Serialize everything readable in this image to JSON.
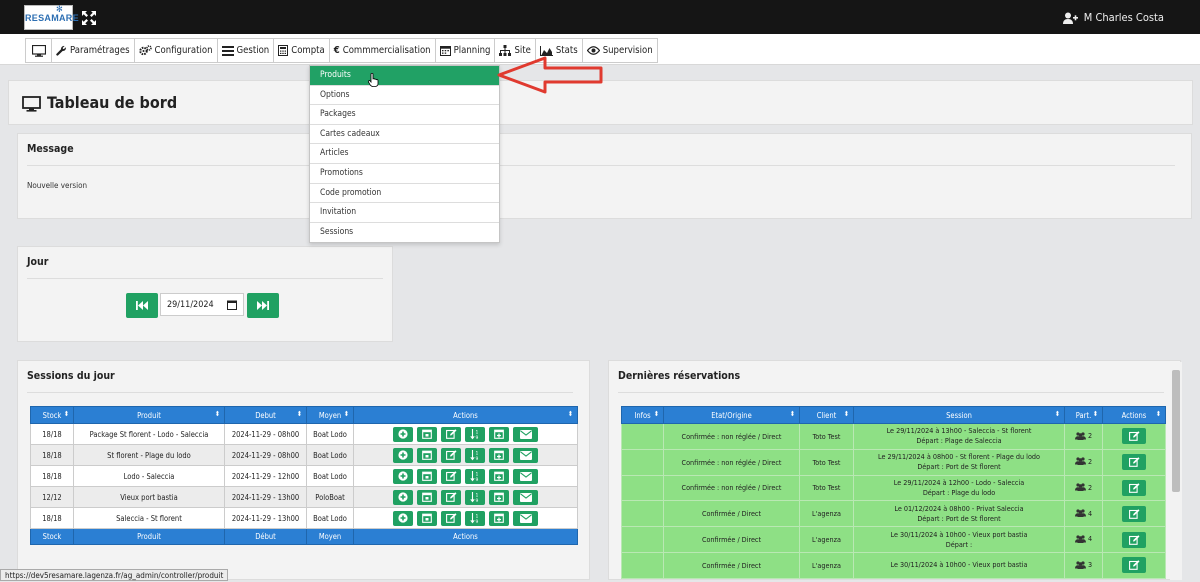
{
  "brand": {
    "logo_text": "RESAMARE"
  },
  "user": {
    "name": "M Charles Costa"
  },
  "menu": [
    {
      "label": ""
    },
    {
      "label": "Paramétrages",
      "icon": "wrench-icon"
    },
    {
      "label": "Configuration",
      "icon": "gears-icon"
    },
    {
      "label": "Gestion",
      "icon": "list-icon"
    },
    {
      "label": "Compta",
      "icon": "calculator-icon"
    },
    {
      "label": "Commmercialisation",
      "icon": "euro-icon"
    },
    {
      "label": "Planning",
      "icon": "calendar-icon"
    },
    {
      "label": "Site",
      "icon": "sitemap-icon"
    },
    {
      "label": "Stats",
      "icon": "area-chart-icon"
    },
    {
      "label": "Supervision",
      "icon": "eye-icon"
    }
  ],
  "dropdown": [
    "Produits",
    "Options",
    "Packages",
    "Cartes cadeaux",
    "Articles",
    "Promotions",
    "Code promotion",
    "Invitation",
    "Sessions"
  ],
  "page": {
    "title": "Tableau de bord"
  },
  "message": {
    "heading": "Message",
    "body": "Nouvelle version"
  },
  "jour": {
    "heading": "Jour",
    "date": "29/11/2024"
  },
  "sessions": {
    "heading": "Sessions du jour",
    "columns": [
      "Stock",
      "Produit",
      "Debut",
      "Moyen",
      "Actions"
    ],
    "footer": [
      "Stock",
      "Produit",
      "Début",
      "Moyen",
      "Actions"
    ],
    "rows": [
      [
        "18/18",
        "Package St florent - Lodo - Saleccia",
        "2024-11-29 - 08h00",
        "Boat Lodo"
      ],
      [
        "18/18",
        "St florent - Plage du lodo",
        "2024-11-29 - 08h00",
        "Boat Lodo"
      ],
      [
        "18/18",
        "Lodo - Saleccia",
        "2024-11-29 - 12h00",
        "Boat Lodo"
      ],
      [
        "12/12",
        "Vieux port bastia",
        "2024-11-29 - 13h00",
        "PoloBoat"
      ],
      [
        "18/18",
        "Saleccia - St florent",
        "2024-11-29 - 13h00",
        "Boat Lodo"
      ]
    ]
  },
  "reservations": {
    "heading": "Dernières réservations",
    "columns": [
      "Infos",
      "Etat/Origine",
      "Client",
      "Session",
      "Part.",
      "Actions"
    ],
    "rows": [
      [
        "",
        "Confirmée : non réglée / Direct",
        "Toto Test",
        "Le 29/11/2024 à 13h00 - Saleccia - St florent",
        "Départ : Plage de Saleccia",
        "2"
      ],
      [
        "",
        "Confirmée : non réglée / Direct",
        "Toto Test",
        "Le 29/11/2024 à 08h00 - St florent - Plage du lodo",
        "Départ : Port de St florent",
        "2"
      ],
      [
        "",
        "Confirmée : non réglée / Direct",
        "Toto Test",
        "Le 29/11/2024 à 12h00 - Lodo - Saleccia",
        "Départ : Plage du lodo",
        "2"
      ],
      [
        "",
        "Confirmée / Direct",
        "L'agenza",
        "Le 01/12/2024 à 08h00 - Privat Saleccia",
        "Départ : Port de St florent",
        "4"
      ],
      [
        "",
        "Confirmée / Direct",
        "L'agenza",
        "Le 30/11/2024 à 10h00 - Vieux port bastia",
        "Départ :",
        "4"
      ],
      [
        "",
        "Confirmée / Direct",
        "L'agenza",
        "Le 30/11/2024 à 10h00 - Vieux port bastia",
        "",
        "3"
      ]
    ]
  },
  "statusbar": {
    "url": "https://dev5resamare.lagenza.fr/ag_admin/controller/produit"
  },
  "colors": {
    "green": "#20a162",
    "blue": "#2b7fd3",
    "arrow": "#e03a2f",
    "row_green": "#8ee085"
  }
}
